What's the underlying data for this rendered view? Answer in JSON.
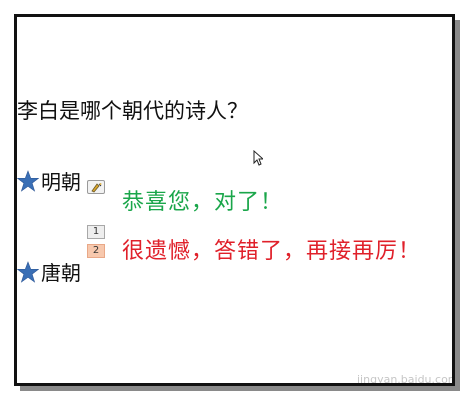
{
  "slide": {
    "question": "李白是哪个朝代的诗人？",
    "options": [
      {
        "label": "明朝",
        "icon": "star-icon"
      },
      {
        "label": "唐朝",
        "icon": "star-icon"
      }
    ],
    "animation_tags": [
      "1",
      "2"
    ],
    "feedback_correct": "恭喜您，对了！",
    "feedback_wrong": "很遗憾，答错了，再接再厉！",
    "colors": {
      "correct": "#1aa64a",
      "wrong": "#e0202a",
      "star": "#3a6fb5"
    }
  },
  "watermark": {
    "text": "jingyan.baidu.com"
  }
}
